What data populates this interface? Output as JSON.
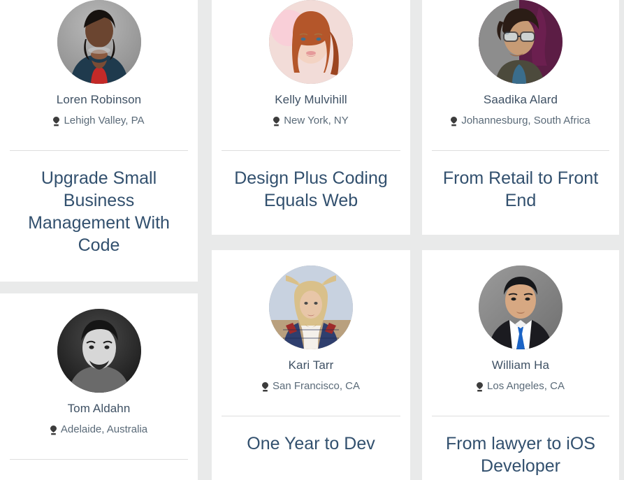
{
  "theme": {
    "page_background": "#e9eaea",
    "card_background": "#ffffff",
    "name_color": "#3f5164",
    "location_color": "#5a6a78",
    "title_color": "#32506e",
    "divider_color": "#dedede"
  },
  "icons": {
    "location": "map-marker-icon"
  },
  "cards": [
    {
      "id": "loren-robinson",
      "name": "Loren Robinson",
      "location": "Lehigh Valley, PA",
      "story_title": "Upgrade Small Business Management With Code",
      "avatar_alt": "Loren Robinson portrait"
    },
    {
      "id": "kelly-mulvihill",
      "name": "Kelly Mulvihill",
      "location": "New York, NY",
      "story_title": "Design Plus Coding Equals Web",
      "avatar_alt": "Kelly Mulvihill portrait"
    },
    {
      "id": "saadika-alard",
      "name": "Saadika Alard",
      "location": "Johannesburg, South Africa",
      "story_title": "From Retail to Front End",
      "avatar_alt": "Saadika Alard portrait"
    },
    {
      "id": "tom-aldahn",
      "name": "Tom Aldahn",
      "location": "Adelaide, Australia",
      "story_title": "",
      "avatar_alt": "Tom Aldahn portrait"
    },
    {
      "id": "kari-tarr",
      "name": "Kari Tarr",
      "location": "San Francisco, CA",
      "story_title": "One Year to Dev",
      "avatar_alt": "Kari Tarr portrait"
    },
    {
      "id": "william-ha",
      "name": "William Ha",
      "location": "Los Angeles, CA",
      "story_title": "From lawyer to iOS Developer",
      "avatar_alt": "William Ha portrait"
    }
  ]
}
